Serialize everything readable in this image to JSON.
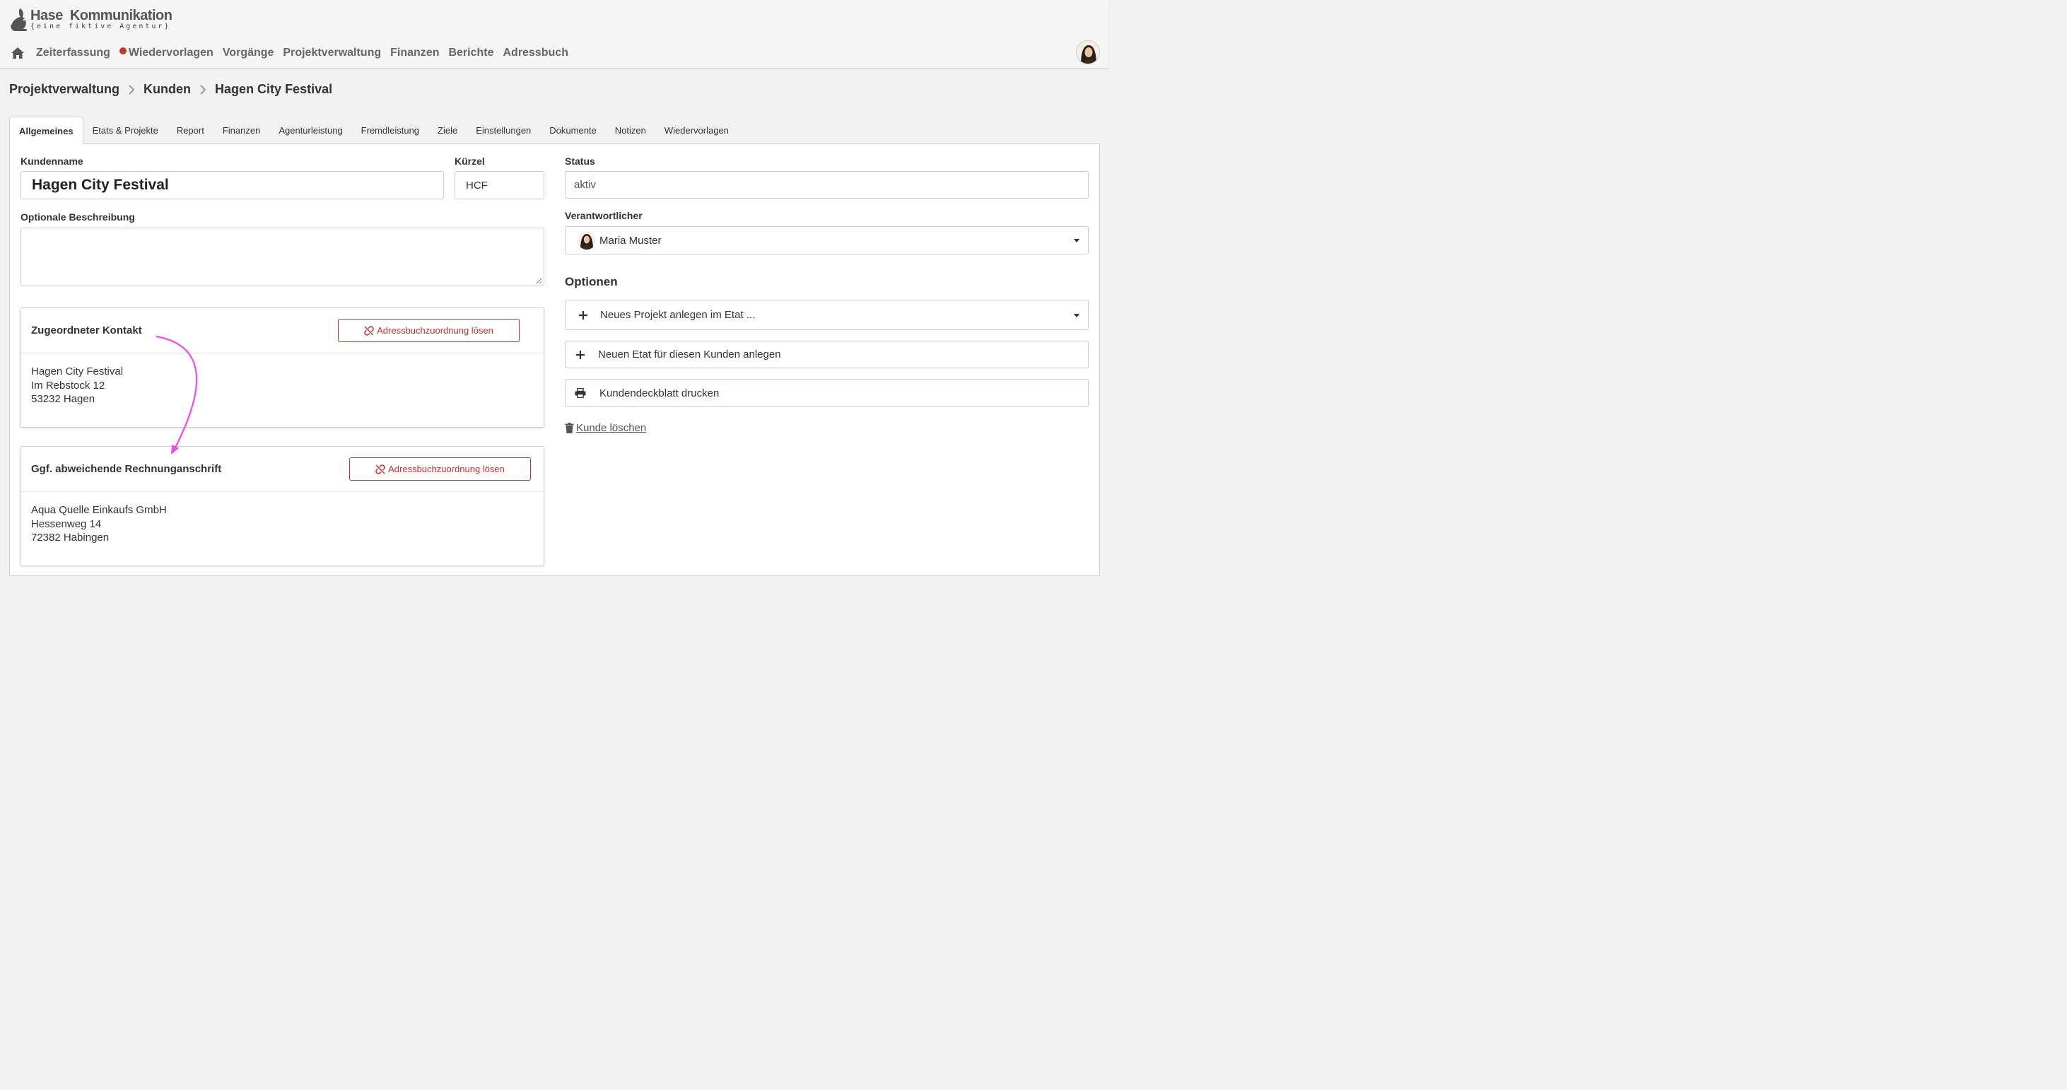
{
  "header": {
    "logo_name_1": "Hase",
    "logo_name_2": "Kommunikation",
    "logo_tagline": "{eine fiktive Agentur}"
  },
  "mainnav": {
    "items": [
      {
        "label": "Zeiterfassung"
      },
      {
        "label": "Wiedervorlagen"
      },
      {
        "label": "Vorgänge"
      },
      {
        "label": "Projektverwaltung"
      },
      {
        "label": "Finanzen"
      },
      {
        "label": "Berichte"
      },
      {
        "label": "Adressbuch"
      }
    ]
  },
  "breadcrumb": {
    "items": [
      "Projektverwaltung",
      "Kunden",
      "Hagen City Festival"
    ]
  },
  "tabs": [
    {
      "label": "Allgemeines",
      "active": true
    },
    {
      "label": "Etats & Projekte"
    },
    {
      "label": "Report"
    },
    {
      "label": "Finanzen"
    },
    {
      "label": "Agenturleistung"
    },
    {
      "label": "Fremdleistung"
    },
    {
      "label": "Ziele"
    },
    {
      "label": "Einstellungen"
    },
    {
      "label": "Dokumente"
    },
    {
      "label": "Notizen"
    },
    {
      "label": "Wiedervorlagen"
    }
  ],
  "form": {
    "kundenname_label": "Kundenname",
    "kundenname_value": "Hagen City Festival",
    "kuerzel_label": "Kürzel",
    "kuerzel_value": "HCF",
    "beschreibung_label": "Optionale Beschreibung",
    "beschreibung_value": "",
    "status_label": "Status",
    "status_value": "aktiv",
    "verantwortlicher_label": "Verantwortlicher",
    "verantwortlicher_value": "Maria Muster"
  },
  "contact_card": {
    "title": "Zugeordneter Kontakt",
    "button_label": "Adressbuchzuordnung lösen",
    "address_lines": [
      "Hagen City Festival",
      "Im Rebstock 12",
      "53232 Hagen"
    ]
  },
  "billing_card": {
    "title": "Ggf. abweichende Rechnunganschrift",
    "button_label": "Adressbuchzuordnung lösen",
    "address_lines": [
      "Aqua Quelle Einkaufs GmbH",
      "Hessenweg 14",
      "72382 Habingen"
    ]
  },
  "options": {
    "title": "Optionen",
    "new_project": "Neues Projekt anlegen im Etat ...",
    "new_etat": "Neuen Etat für diesen Kunden anlegen",
    "print_cover": "Kundendeckblatt drucken",
    "delete": "Kunde löschen"
  },
  "colors": {
    "accent_red": "#c9302c",
    "annotation_magenta": "#e94fe9",
    "nav_text": "#666666"
  }
}
